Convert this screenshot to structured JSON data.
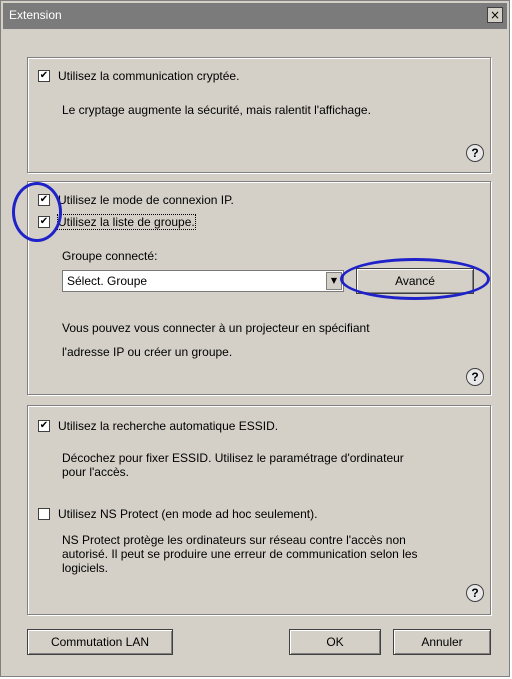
{
  "window": {
    "title": "Extension",
    "close_glyph": "×"
  },
  "section1": {
    "checkbox_label": "Utilisez la communication cryptée.",
    "checked": true,
    "description": "Le cryptage augmente la sécurité, mais ralentit l'affichage."
  },
  "section2": {
    "ip_mode_label": "Utilisez le mode de connexion IP.",
    "ip_mode_checked": true,
    "group_list_label": "Utilisez la liste de groupe.",
    "group_list_checked": true,
    "connected_group_label": "Groupe connecté:",
    "group_select_value": "Sélect. Groupe",
    "advanced_button": "Avancé",
    "description_line1": "Vous pouvez vous connecter à un projecteur en spécifiant",
    "description_line2": "l'adresse IP ou créer un groupe."
  },
  "section3": {
    "essid_label": "Utilisez la recherche automatique ESSID.",
    "essid_checked": true,
    "essid_desc_line1": "Décochez pour fixer ESSID. Utilisez le paramétrage d'ordinateur",
    "essid_desc_line2": "pour l'accès.",
    "ns_protect_label": "Utilisez NS Protect (en mode ad hoc seulement).",
    "ns_protect_checked": false,
    "ns_desc_line1": "NS Protect protège les ordinateurs sur réseau contre l'accès non",
    "ns_desc_line2": "autorisé. Il peut se produire une erreur de communication selon les",
    "ns_desc_line3": "logiciels."
  },
  "help_glyph": "?",
  "check_glyph": "✔",
  "footer": {
    "lan_button": "Commutation LAN",
    "ok_button": "OK",
    "cancel_button": "Annuler"
  },
  "annotation_color": "#1f22c8"
}
